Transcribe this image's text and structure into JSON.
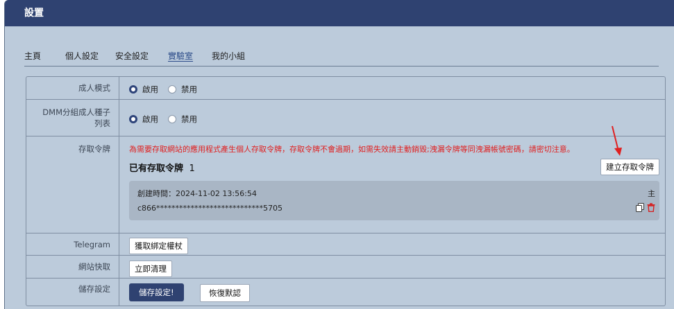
{
  "window": {
    "title": "設置"
  },
  "tabs": [
    {
      "label": "主頁",
      "active": false
    },
    {
      "label": "個人設定",
      "active": false
    },
    {
      "label": "安全設定",
      "active": false
    },
    {
      "label": "實驗室",
      "active": true
    },
    {
      "label": "我的小組",
      "active": false
    }
  ],
  "adult_mode": {
    "label": "成人模式",
    "options": [
      {
        "label": "啟用",
        "checked": true
      },
      {
        "label": "禁用",
        "checked": false
      }
    ]
  },
  "dmm_adult": {
    "label_line1": "DMM分組成人種子",
    "label_line2": "列表",
    "options": [
      {
        "label": "啟用",
        "checked": true
      },
      {
        "label": "禁用",
        "checked": false
      }
    ]
  },
  "access_token": {
    "label": "存取令牌",
    "warning": "為需要存取網站的應用程式產生個人存取令牌，存取令牌不會過期，如需失效請主動銷毀;洩漏令牌等同洩漏帳號密碼，請密切注意。",
    "heading": "已有存取令牌",
    "count": "1",
    "create_button": "建立存取令牌",
    "tokens": [
      {
        "created": "創建時間：2024-11-02 13:56:54",
        "value": "c866****************************5705",
        "tag": "主"
      }
    ]
  },
  "telegram": {
    "label": "Telegram",
    "button": "獲取綁定權杖"
  },
  "site_cache": {
    "label": "網站快取",
    "button": "立即清理"
  },
  "save": {
    "label": "儲存設定",
    "primary_button": "儲存設定!",
    "reset_button": "恢復默認"
  },
  "colors": {
    "header": "#2f4271",
    "panel": "#bccbdb",
    "warning": "#e02020",
    "primary": "#2f4271",
    "delete": "#d52020"
  }
}
